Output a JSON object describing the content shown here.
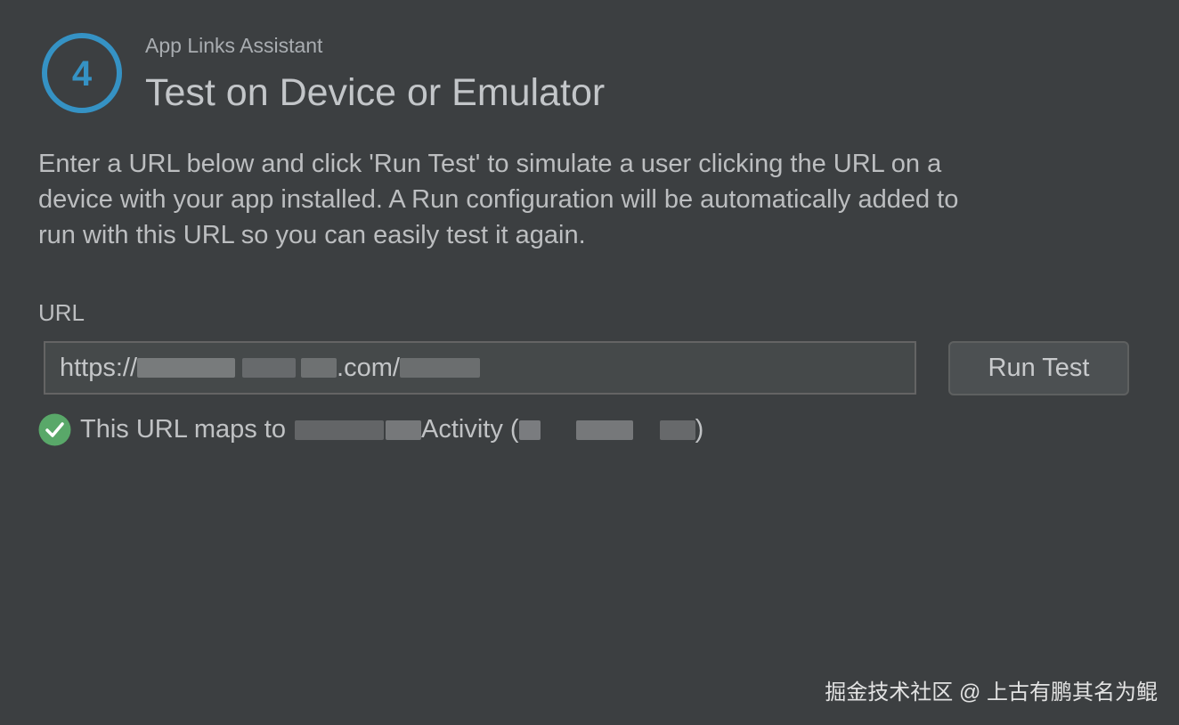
{
  "header": {
    "step_number": "4",
    "assistant_name": "App Links Assistant",
    "title": "Test on Device or Emulator"
  },
  "description": {
    "lines": [
      "Enter a URL below and click 'Run Test' to simulate a user clicking the URL on a",
      "device with your app installed. A Run configuration will be automatically added to",
      "run with this URL so you can easily test it again."
    ]
  },
  "url_section": {
    "label": "URL",
    "value_prefix": "https://",
    "value_visible_middle": ".com/",
    "run_button_label": "Run Test"
  },
  "status": {
    "text_prefix": "This URL maps to",
    "activity_suffix": "Activity (",
    "close_paren": ")",
    "icon": "check-circle-icon",
    "icon_color": "#59a869"
  },
  "watermark": {
    "text": "掘金技术社区 @ 上古有鹏其名为鲲"
  },
  "colors": {
    "background": "#3c3f41",
    "accent_blue": "#3592c4",
    "input_background": "#45494a",
    "button_background": "#4c5052"
  }
}
